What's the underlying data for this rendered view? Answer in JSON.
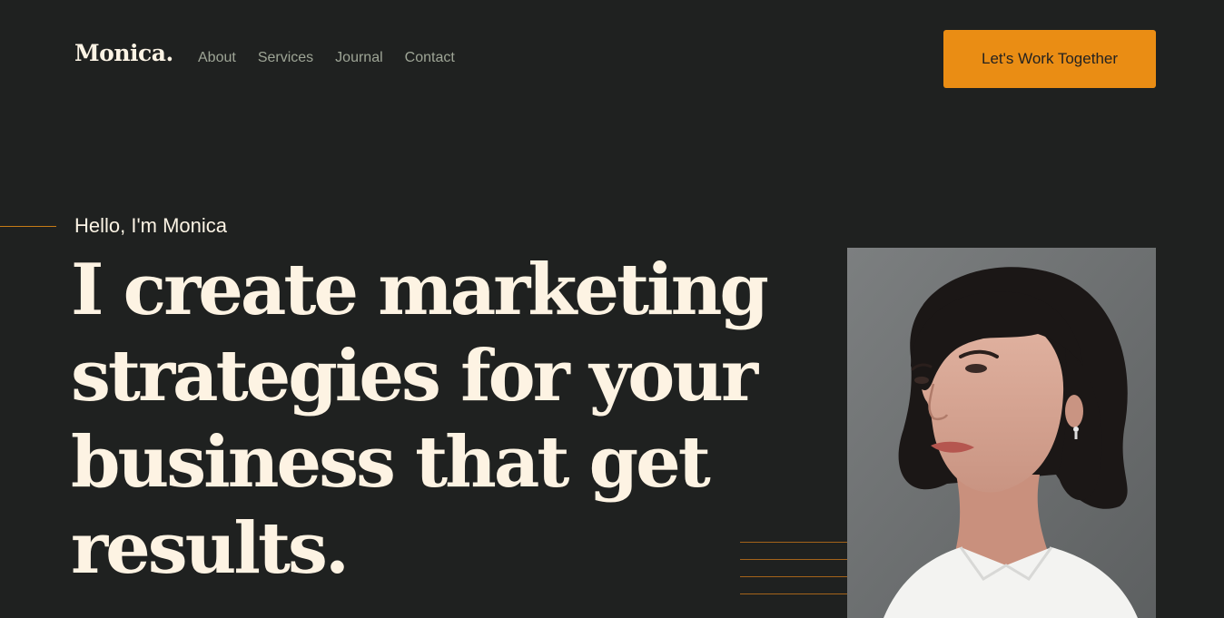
{
  "header": {
    "logo": "Monica.",
    "nav": [
      "About",
      "Services",
      "Journal",
      "Contact"
    ],
    "cta_label": "Let's Work Together"
  },
  "hero": {
    "greeting": "Hello, I'm Monica",
    "headline_lines": [
      "I create marketing",
      "strategies for your",
      "business that get",
      "results."
    ],
    "photo_alt": "Portrait of Monica"
  },
  "colors": {
    "background": "#1f2120",
    "accent": "#ea8d14",
    "heading": "#fdf3e3",
    "nav_text": "#9ea596"
  },
  "icons": []
}
